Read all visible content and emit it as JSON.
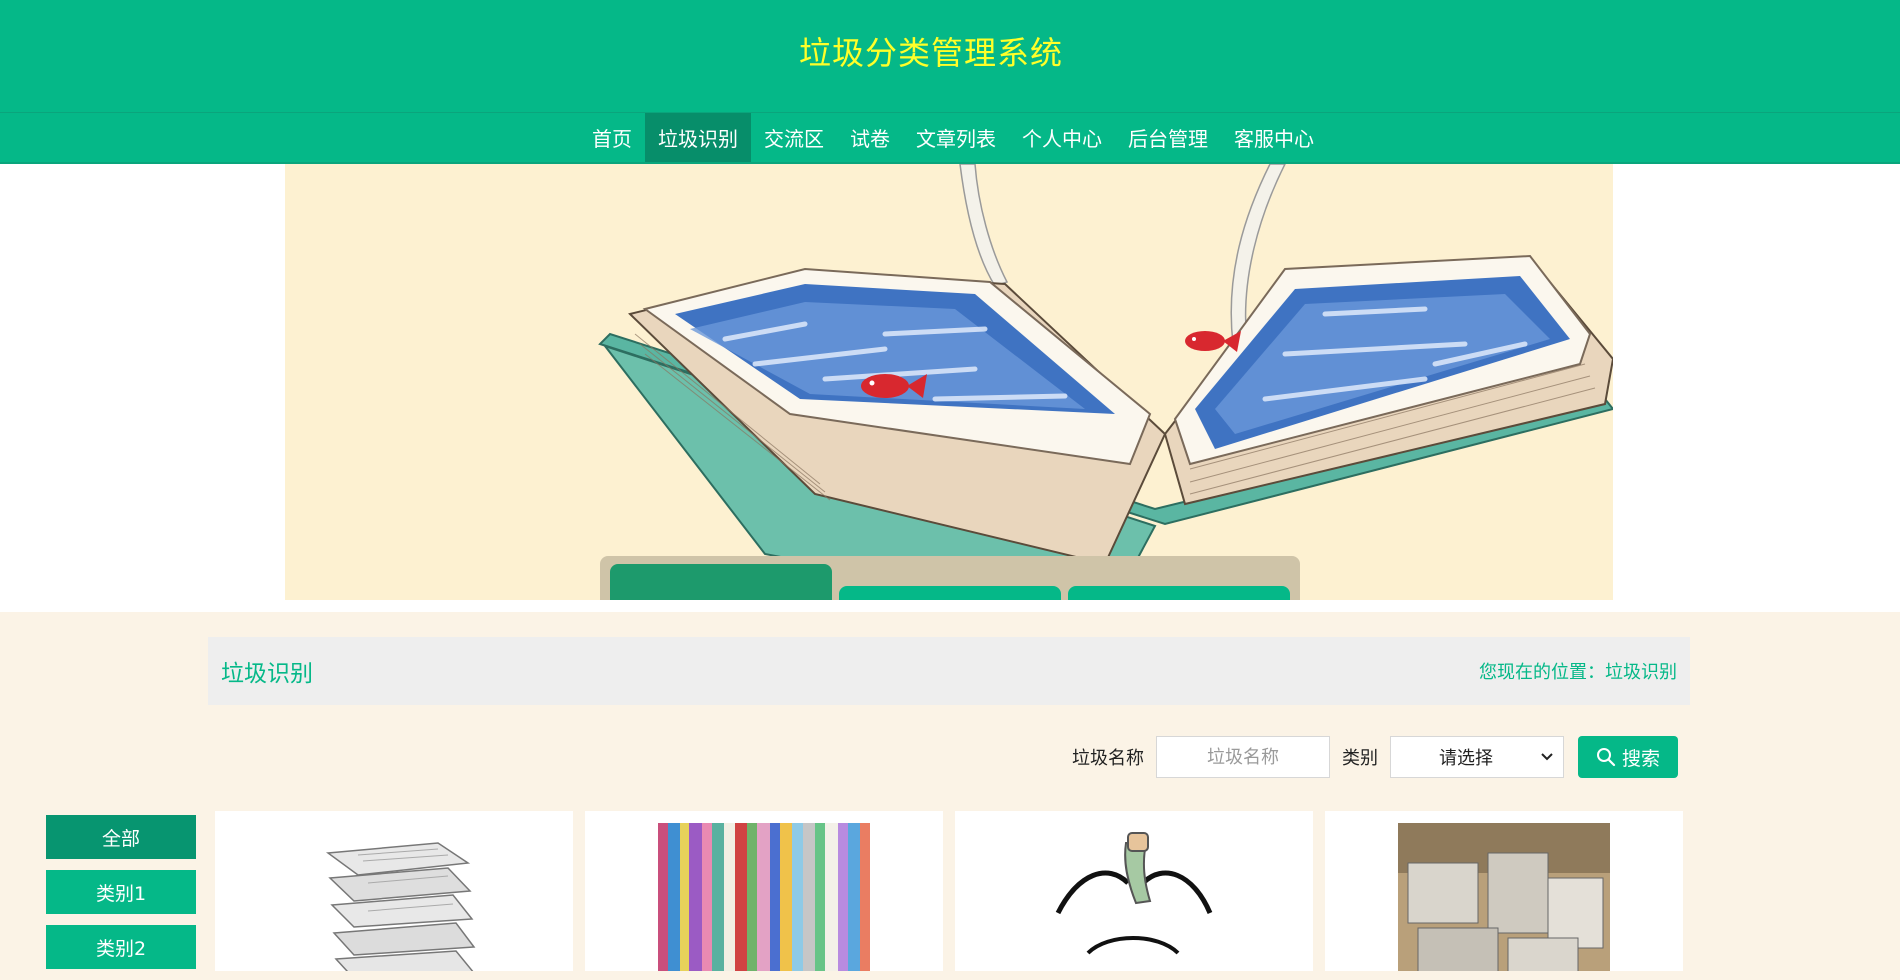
{
  "header": {
    "title": "垃圾分类管理系统"
  },
  "nav": {
    "items": [
      {
        "label": "首页",
        "active": false
      },
      {
        "label": "垃圾识别",
        "active": true
      },
      {
        "label": "交流区",
        "active": false
      },
      {
        "label": "试卷",
        "active": false
      },
      {
        "label": "文章列表",
        "active": false
      },
      {
        "label": "个人中心",
        "active": false
      },
      {
        "label": "后台管理",
        "active": false
      },
      {
        "label": "客服中心",
        "active": false
      }
    ]
  },
  "page": {
    "title": "垃圾识别",
    "breadcrumb": "您现在的位置：垃圾识别"
  },
  "search": {
    "name_label": "垃圾名称",
    "name_placeholder": "垃圾名称",
    "name_value": "",
    "category_label": "类别",
    "category_selected": "请选择",
    "button_label": "搜索"
  },
  "categories": [
    "全部",
    "类别1",
    "类别2"
  ],
  "colors": {
    "primary": "#05b888",
    "primary_dark": "#078e6a",
    "title_yellow": "#ffff29",
    "page_bg": "#fbf3e6"
  },
  "icons": {
    "search": "magnifier-icon",
    "dropdown": "chevron-down-icon"
  }
}
